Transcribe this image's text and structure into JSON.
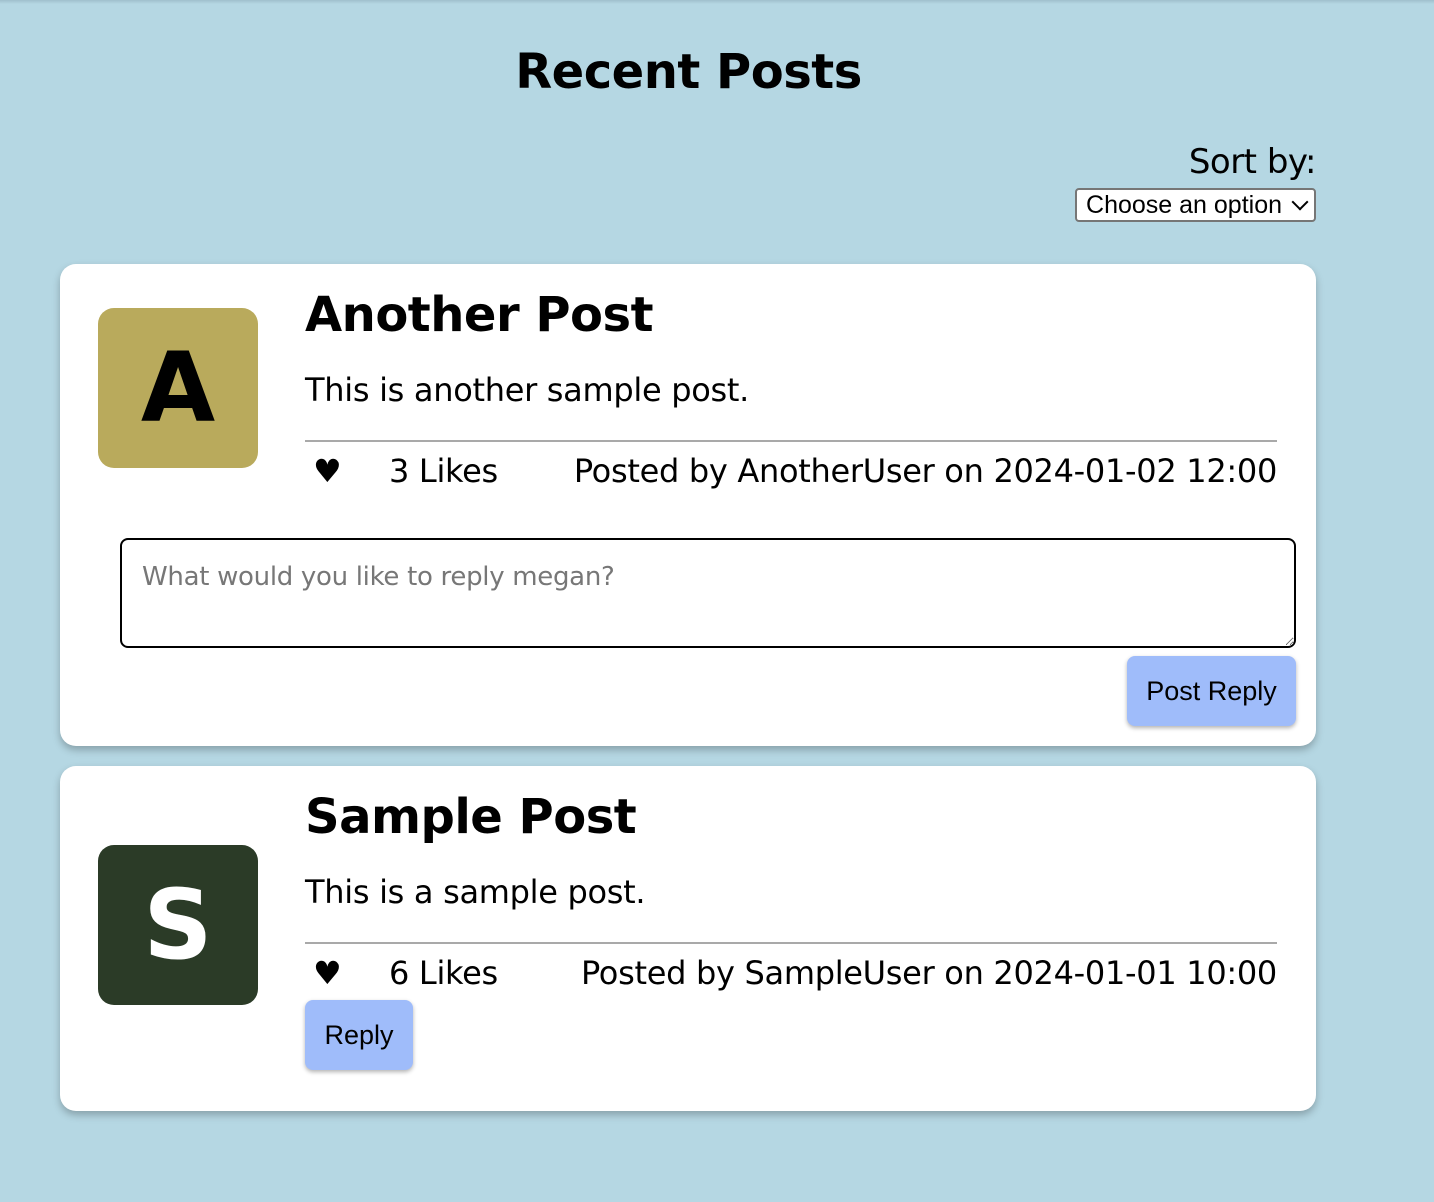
{
  "page": {
    "title": "Recent Posts"
  },
  "sort": {
    "label": "Sort by:",
    "selected": "Choose an option"
  },
  "posts": [
    {
      "avatar_letter": "A",
      "avatar_color": "#b9aa5c",
      "avatar_text_color": "#000000",
      "title": "Another Post",
      "body": "This is another sample post.",
      "likes": "3 Likes",
      "meta": "Posted by AnotherUser on 2024-01-02 12:00",
      "heart_icon": "♥",
      "reply_placeholder": "What would you like to reply megan?",
      "reply_button": "Post Reply"
    },
    {
      "avatar_letter": "S",
      "avatar_color": "#2b3b27",
      "avatar_text_color": "#ffffff",
      "title": "Sample Post",
      "body": "This is a sample post.",
      "likes": "6 Likes",
      "meta": "Posted by SampleUser on 2024-01-01 10:00",
      "heart_icon": "♥",
      "reply_button": "Reply"
    }
  ],
  "colors": {
    "background": "#b5d7e3",
    "button": "#9fbcfa"
  }
}
